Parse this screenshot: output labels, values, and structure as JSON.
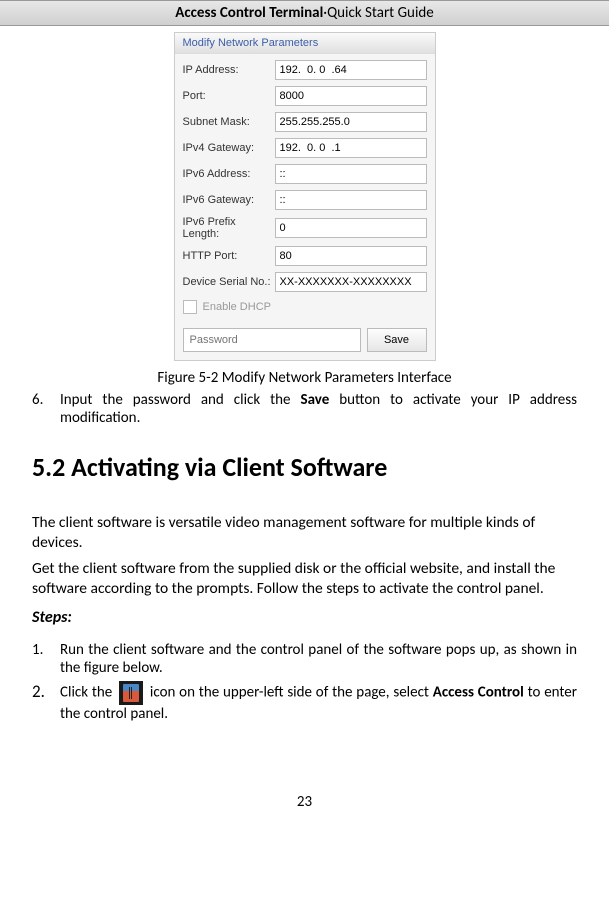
{
  "header": {
    "title_bold": "Access Control Terminal",
    "title_sep": "·",
    "title_rest": "Quick Start Guide"
  },
  "dialog": {
    "title": "Modify Network Parameters",
    "fields": {
      "ip_label": "IP Address:",
      "ip_value": "192.  0. 0  .64",
      "port_label": "Port:",
      "port_value": "8000",
      "subnet_label": "Subnet Mask:",
      "subnet_value": "255.255.255.0",
      "gw4_label": "IPv4 Gateway:",
      "gw4_value": "192.  0. 0  .1",
      "ip6_label": "IPv6 Address:",
      "ip6_value": "::",
      "gw6_label": "IPv6 Gateway:",
      "gw6_value": "::",
      "prefix_label": "IPv6 Prefix Length:",
      "prefix_value": "0",
      "http_label": "HTTP Port:",
      "http_value": "80",
      "serial_label": "Device Serial No.:",
      "serial_value": "XX-XXXXXXX-XXXXXXXX"
    },
    "dhcp_label": "Enable DHCP",
    "password_placeholder": "Password",
    "save_label": "Save"
  },
  "figure_caption": "Figure 5-2 Modify Network Parameters Interface",
  "step6": {
    "num": "6.",
    "text_before": "Input the password and click the ",
    "text_bold": "Save",
    "text_after": " button to activate your IP address modification."
  },
  "section_heading": "5.2 Activating via Client Software",
  "para1": "The client software is versatile video management software for multiple kinds of devices.",
  "para2": "Get the client software from the supplied disk or the official website, and install the software according to the prompts. Follow the steps to activate the control panel.",
  "steps_label": "Steps:",
  "steps": {
    "s1_num": "1.",
    "s1_text": "Run the client software and the control panel of the software pops up, as shown in the figure below.",
    "s2_num": "2.",
    "s2_before": "Click the ",
    "s2_after_icon": " icon on the upper-left side of the page, select ",
    "s2_bold": "Access Control",
    "s2_end": " to enter the control panel."
  },
  "page_number": "23"
}
